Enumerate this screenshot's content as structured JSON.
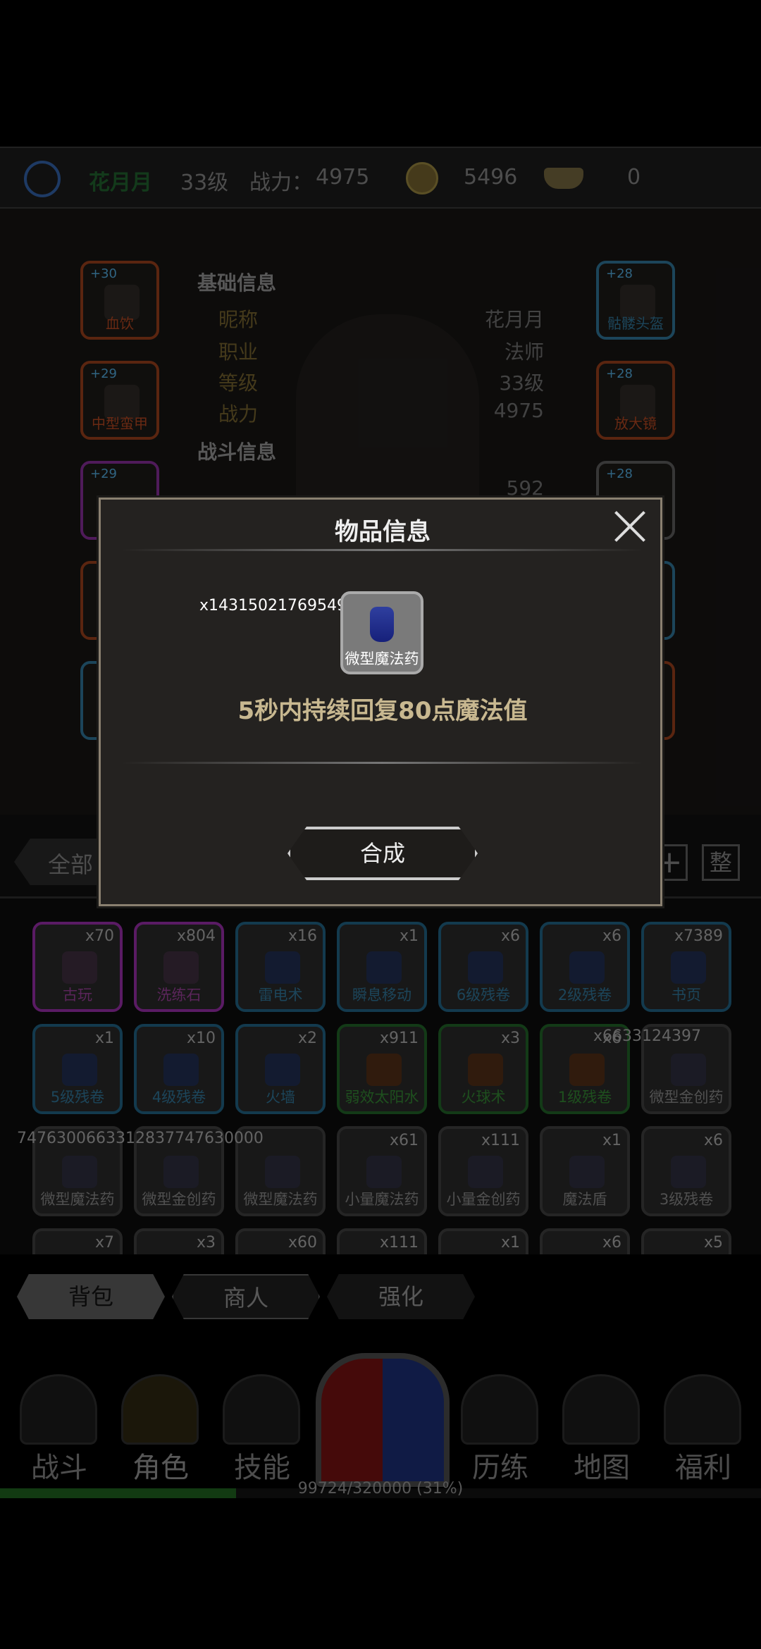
{
  "header": {
    "player_name": "花月月",
    "level": "33级",
    "power_label": "战力：",
    "power_value": "4975",
    "coins": "5496",
    "gold_ingots": "0"
  },
  "character": {
    "basic_section": "基础信息",
    "combat_section": "战斗信息",
    "rows": [
      {
        "label": "昵称",
        "value": "花月月"
      },
      {
        "label": "职业",
        "value": "法师"
      },
      {
        "label": "等级",
        "value": "33级"
      },
      {
        "label": "战力",
        "value": "4975"
      }
    ],
    "combat_partial_value": "592",
    "equip_left": [
      {
        "level": "+30",
        "name": "血饮"
      },
      {
        "level": "+29",
        "name": "中型蛮甲"
      },
      {
        "level": "+29",
        "name": ""
      },
      {
        "level": "",
        "name": ""
      },
      {
        "level": "",
        "name": ""
      }
    ],
    "equip_right": [
      {
        "level": "+28",
        "name": "骷髅头盔"
      },
      {
        "level": "+28",
        "name": "放大镜"
      },
      {
        "level": "+28",
        "name": ""
      }
    ]
  },
  "filter": {
    "all_label": "全部",
    "plus_label": "+",
    "sort_label": "整"
  },
  "inventory": [
    {
      "qty": "x70",
      "name": "古玩",
      "rarity": "purple"
    },
    {
      "qty": "x804",
      "name": "洗练石",
      "rarity": "purple"
    },
    {
      "qty": "x16",
      "name": "雷电术",
      "rarity": "blue"
    },
    {
      "qty": "x1",
      "name": "瞬息移动",
      "rarity": "blue"
    },
    {
      "qty": "x6",
      "name": "6级残卷",
      "rarity": "blue"
    },
    {
      "qty": "x6",
      "name": "2级残卷",
      "rarity": "blue"
    },
    {
      "qty": "x7389",
      "name": "书页",
      "rarity": "blue"
    },
    {
      "qty": "x1",
      "name": "5级残卷",
      "rarity": "blue"
    },
    {
      "qty": "x10",
      "name": "4级残卷",
      "rarity": "blue"
    },
    {
      "qty": "x2",
      "name": "火墙",
      "rarity": "blue"
    },
    {
      "qty": "x911",
      "name": "弱效太阳水",
      "rarity": "green"
    },
    {
      "qty": "x3",
      "name": "火球术",
      "rarity": "green"
    },
    {
      "qty": "x6",
      "name": "1级残卷",
      "rarity": "green"
    },
    {
      "qty": "",
      "name": "微型金创药",
      "rarity": "grey"
    },
    {
      "qty": "",
      "name": "微型魔法药",
      "rarity": "grey"
    },
    {
      "qty": "",
      "name": "微型金创药",
      "rarity": "grey"
    },
    {
      "qty": "",
      "name": "微型魔法药",
      "rarity": "grey"
    },
    {
      "qty": "x61",
      "name": "小量魔法药",
      "rarity": "grey"
    },
    {
      "qty": "x111",
      "name": "小量金创药",
      "rarity": "grey"
    },
    {
      "qty": "x1",
      "name": "魔法盾",
      "rarity": "grey"
    },
    {
      "qty": "x6",
      "name": "3级残卷",
      "rarity": "grey"
    },
    {
      "qty": "x7",
      "name": "",
      "rarity": "grey"
    },
    {
      "qty": "x3",
      "name": "",
      "rarity": "grey"
    },
    {
      "qty": "x60",
      "name": "",
      "rarity": "grey"
    },
    {
      "qty": "x111",
      "name": "",
      "rarity": "grey"
    },
    {
      "qty": "x1",
      "name": "",
      "rarity": "grey"
    },
    {
      "qty": "x6",
      "name": "",
      "rarity": "grey"
    },
    {
      "qty": "x5",
      "name": "",
      "rarity": "grey"
    }
  ],
  "overflow_quantities": {
    "row2_end": "x6633124397",
    "row3_start": "7476300663312837747630000"
  },
  "bottom_tabs": [
    "背包",
    "商人",
    "强化"
  ],
  "nav": [
    "战斗",
    "角色",
    "技能",
    "历练",
    "地图",
    "福利"
  ],
  "xp_text": "99724/320000 (31%)",
  "xp_fraction": 0.31,
  "dialog": {
    "title": "物品信息",
    "item_qty": "x143150217695495260000",
    "item_name": "微型魔法药",
    "desc": "5秒内持续回复80点魔法值",
    "combine_label": "合成"
  }
}
